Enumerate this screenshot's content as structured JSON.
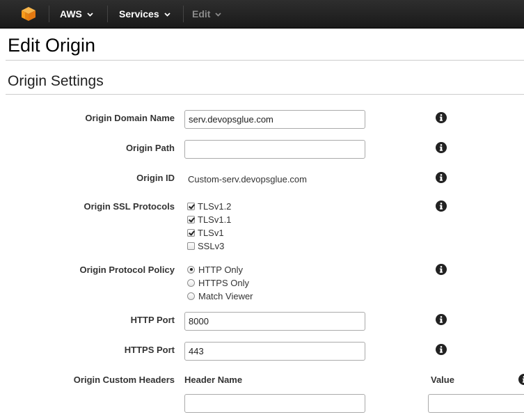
{
  "nav": {
    "logo_icon": "aws-cube-icon",
    "aws_label": "AWS",
    "services_label": "Services",
    "edit_label": "Edit",
    "logo_color": "#f89c1c"
  },
  "page": {
    "title": "Edit Origin",
    "section_title": "Origin Settings"
  },
  "form": {
    "origin_domain_name": {
      "label": "Origin Domain Name",
      "value": "serv.devopsglue.com"
    },
    "origin_path": {
      "label": "Origin Path",
      "value": ""
    },
    "origin_id": {
      "label": "Origin ID",
      "value": "Custom-serv.devopsglue.com"
    },
    "ssl_protocols": {
      "label": "Origin SSL Protocols",
      "options": [
        {
          "label": "TLSv1.2",
          "checked": true
        },
        {
          "label": "TLSv1.1",
          "checked": true
        },
        {
          "label": "TLSv1",
          "checked": true
        },
        {
          "label": "SSLv3",
          "checked": false
        }
      ]
    },
    "protocol_policy": {
      "label": "Origin Protocol Policy",
      "options": [
        {
          "label": "HTTP Only",
          "selected": true
        },
        {
          "label": "HTTPS Only",
          "selected": false
        },
        {
          "label": "Match Viewer",
          "selected": false
        }
      ]
    },
    "http_port": {
      "label": "HTTP Port",
      "value": "8000"
    },
    "https_port": {
      "label": "HTTPS Port",
      "value": "443"
    },
    "custom_headers": {
      "label": "Origin Custom Headers",
      "header_name_col": "Header Name",
      "value_col": "Value",
      "header_name_value": "",
      "value_value": ""
    }
  }
}
